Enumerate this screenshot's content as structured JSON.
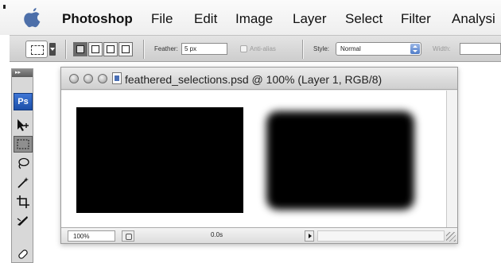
{
  "menubar": {
    "app_name": "Photoshop",
    "items": [
      "File",
      "Edit",
      "Image",
      "Layer",
      "Select",
      "Filter",
      "Analysi"
    ]
  },
  "options_bar": {
    "feather_label": "Feather:",
    "feather_value": "5 px",
    "anti_alias_label": "Anti-alias",
    "style_label": "Style:",
    "style_value": "Normal",
    "width_label": "Width:"
  },
  "toolbox": {
    "logo": "Ps",
    "grip": "▸▸"
  },
  "document": {
    "title": "feathered_selections.psd @ 100% (Layer 1, RGB/8)",
    "zoom": "100%",
    "timing": "0.0s"
  }
}
